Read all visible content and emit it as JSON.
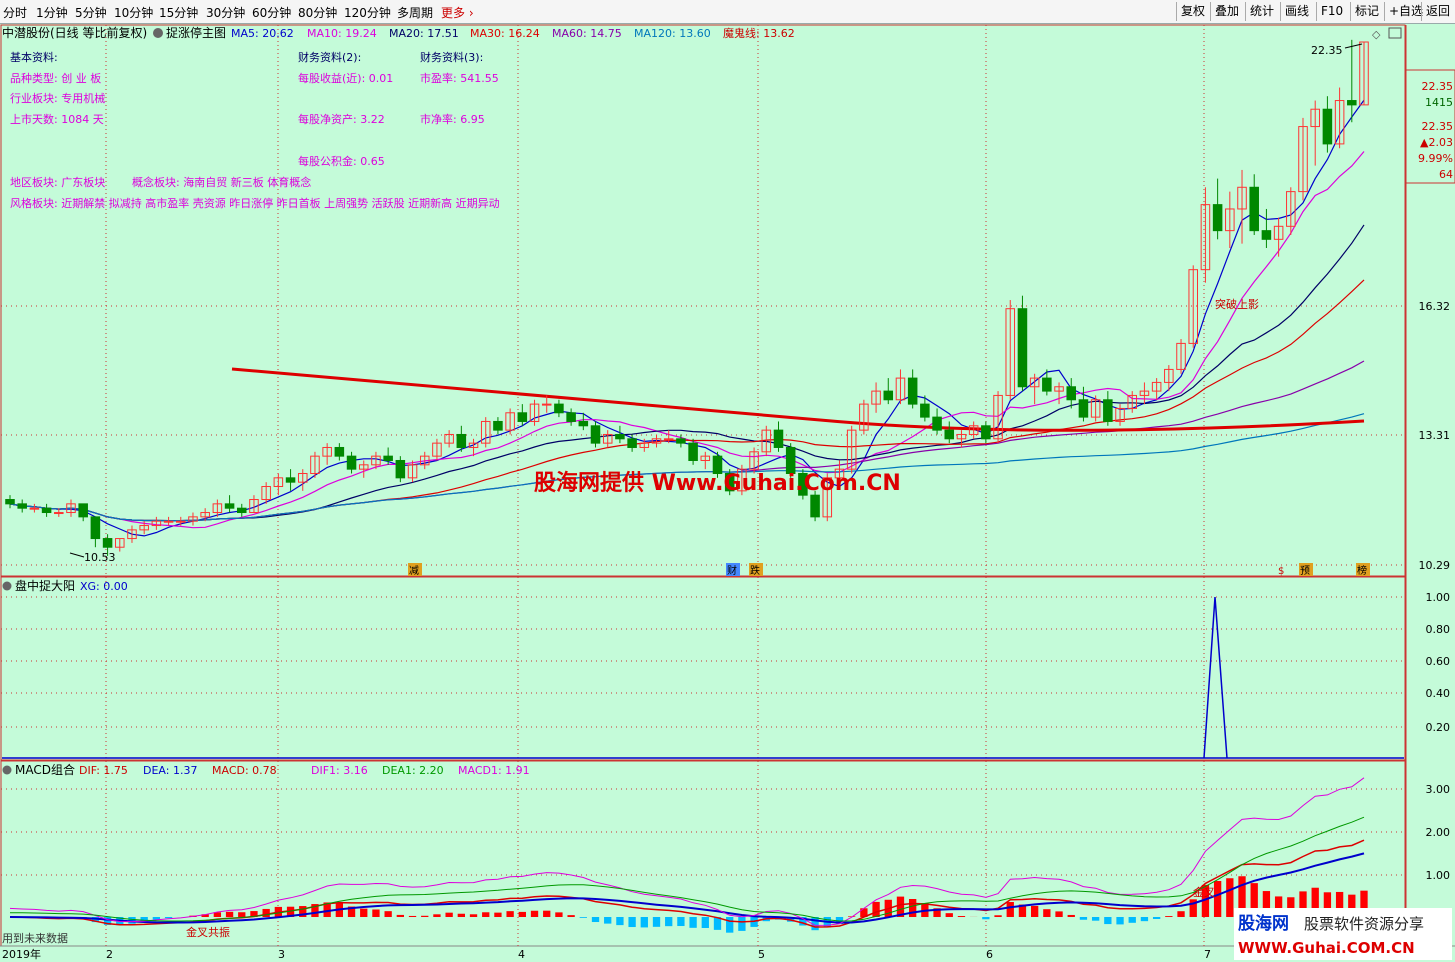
{
  "toolbar": {
    "timeframes": [
      "分时",
      "1分钟",
      "5分钟",
      "10分钟",
      "15分钟",
      "30分钟",
      "60分钟",
      "80分钟",
      "120分钟",
      "多周期"
    ],
    "more": "更多",
    "right_buttons": [
      "复权",
      "叠加",
      "统计",
      "画线",
      "F10",
      "标记",
      "+自选",
      "返回"
    ]
  },
  "header": {
    "title": "中潜股份(日线 等比前复权)",
    "indicator_name": "捉涨停主图",
    "ma": [
      {
        "label": "MA5: 20.62",
        "color": "#0000cc"
      },
      {
        "label": "MA10: 19.24",
        "color": "#dd00dd"
      },
      {
        "label": "MA20: 17.51",
        "color": "#000066"
      },
      {
        "label": "MA30: 16.24",
        "color": "#dd0000"
      },
      {
        "label": "MA60: 14.75",
        "color": "#8800aa"
      },
      {
        "label": "MA120: 13.60",
        "color": "#0077bb"
      },
      {
        "label": "魔鬼线: 13.62",
        "color": "#cc0000"
      }
    ]
  },
  "info": {
    "basic_title": "基本资料:",
    "basic": [
      "品种类型:  创 业 板",
      "行业板块:  专用机械",
      "上市天数: 1084    天"
    ],
    "fin2_title": "财务资料(2):",
    "fin2": [
      "每股收益(近): 0.01",
      "每股净资产:  3.22",
      "每股公积金:  0.65"
    ],
    "fin3_title": "财务资料(3):",
    "fin3": [
      "市盈率: 541.55",
      "市净率:   6.95"
    ],
    "region": "地区板块: 广东板块",
    "concept": "概念板块: 海南自贸 新三板 体育概念",
    "style": "风格板块: 近期解禁 拟减持 高市盈率 壳资源 昨日涨停 昨日首板 上周强势 活跃股 近期新高 近期异动"
  },
  "quote_box": {
    "high": "22.35",
    "vol": "1415",
    "price": "22.35",
    "change": "▲2.03",
    "pct": "9.99%",
    "num": "64"
  },
  "price_axis": [
    "16.32",
    "13.31",
    "10.29"
  ],
  "max_label": "22.35",
  "min_label": "10.53",
  "breakout_label": "突破上影",
  "watermark": "股海网提供 Www.Guhai.Com.CN",
  "event_markers": [
    "减",
    "财",
    "跌",
    "$",
    "预",
    "榜"
  ],
  "panel2": {
    "title": "盘中捉大阳",
    "xg": "XG: 0.00",
    "axis": [
      "1.00",
      "0.80",
      "0.60",
      "0.40",
      "0.20"
    ]
  },
  "panel3": {
    "title": "MACD组合",
    "items": [
      {
        "label": "DIF: 1.75",
        "color": "#cc0000"
      },
      {
        "label": "DEA: 1.37",
        "color": "#0000cc"
      },
      {
        "label": "MACD: 0.78",
        "color": "#cc0000"
      },
      {
        "label": "DIF1: 3.16",
        "color": "#dd00dd"
      },
      {
        "label": "DEA1: 2.20",
        "color": "#009900"
      },
      {
        "label": "MACD1: 1.91",
        "color": "#dd00dd"
      }
    ],
    "axis": [
      "3.00",
      "2.00",
      "1.00"
    ],
    "golden_cross": "金叉共振",
    "golden_cross2": "金叉",
    "future_note": "用到未来数据"
  },
  "date_axis": [
    "2019年",
    "2",
    "3",
    "4",
    "5",
    "6",
    "7"
  ],
  "logo": {
    "brand": "股海网",
    "tagline": "股票软件资源分享",
    "url": "WWW.Guhai.COM.CN"
  },
  "colors": {
    "bg": "#c4fbd9",
    "up": "#ff3333",
    "down": "#008800",
    "grid": "#cc3333",
    "axis": "#990000"
  },
  "chart_data": {
    "type": "candlestick",
    "x_months": [
      "1",
      "2",
      "3",
      "4",
      "5",
      "6",
      "7"
    ],
    "ylim": [
      10.0,
      23.0
    ],
    "y_ticks": [
      16.32,
      13.31,
      10.29
    ],
    "candles": [
      [
        11.8,
        11.9,
        11.6,
        11.7
      ],
      [
        11.7,
        11.8,
        11.5,
        11.6
      ],
      [
        11.6,
        11.7,
        11.5,
        11.6
      ],
      [
        11.6,
        11.7,
        11.4,
        11.5
      ],
      [
        11.5,
        11.6,
        11.4,
        11.5
      ],
      [
        11.5,
        11.8,
        11.4,
        11.7
      ],
      [
        11.7,
        11.7,
        11.3,
        11.4
      ],
      [
        11.4,
        11.4,
        10.7,
        10.9
      ],
      [
        10.9,
        11.0,
        10.5,
        10.7
      ],
      [
        10.7,
        10.9,
        10.6,
        10.9
      ],
      [
        10.9,
        11.2,
        10.8,
        11.1
      ],
      [
        11.1,
        11.3,
        11.0,
        11.2
      ],
      [
        11.2,
        11.4,
        11.1,
        11.3
      ],
      [
        11.3,
        11.4,
        11.2,
        11.3
      ],
      [
        11.3,
        11.4,
        11.2,
        11.3
      ],
      [
        11.3,
        11.5,
        11.2,
        11.4
      ],
      [
        11.4,
        11.6,
        11.3,
        11.5
      ],
      [
        11.5,
        11.8,
        11.4,
        11.7
      ],
      [
        11.7,
        11.9,
        11.5,
        11.6
      ],
      [
        11.6,
        11.7,
        11.4,
        11.5
      ],
      [
        11.5,
        11.9,
        11.5,
        11.8
      ],
      [
        11.8,
        12.2,
        11.7,
        12.1
      ],
      [
        12.1,
        12.4,
        11.9,
        12.3
      ],
      [
        12.3,
        12.5,
        12.0,
        12.2
      ],
      [
        12.2,
        12.5,
        12.0,
        12.4
      ],
      [
        12.4,
        12.9,
        12.3,
        12.8
      ],
      [
        12.8,
        13.1,
        12.6,
        13.0
      ],
      [
        13.0,
        13.1,
        12.7,
        12.8
      ],
      [
        12.8,
        12.9,
        12.4,
        12.5
      ],
      [
        12.5,
        12.7,
        12.3,
        12.6
      ],
      [
        12.6,
        12.9,
        12.5,
        12.8
      ],
      [
        12.8,
        13.0,
        12.6,
        12.7
      ],
      [
        12.7,
        12.8,
        12.2,
        12.3
      ],
      [
        12.3,
        12.7,
        12.2,
        12.6
      ],
      [
        12.6,
        12.9,
        12.5,
        12.8
      ],
      [
        12.8,
        13.2,
        12.7,
        13.1
      ],
      [
        13.1,
        13.4,
        13.0,
        13.3
      ],
      [
        13.3,
        13.5,
        12.9,
        13.0
      ],
      [
        13.0,
        13.2,
        12.8,
        13.1
      ],
      [
        13.1,
        13.7,
        13.0,
        13.6
      ],
      [
        13.6,
        13.7,
        13.3,
        13.4
      ],
      [
        13.4,
        13.9,
        13.3,
        13.8
      ],
      [
        13.8,
        14.0,
        13.5,
        13.6
      ],
      [
        13.6,
        14.1,
        13.5,
        14.0
      ],
      [
        14.0,
        14.2,
        13.8,
        14.0
      ],
      [
        14.0,
        14.1,
        13.7,
        13.8
      ],
      [
        13.8,
        13.9,
        13.5,
        13.6
      ],
      [
        13.6,
        13.8,
        13.4,
        13.5
      ],
      [
        13.5,
        13.6,
        13.0,
        13.1
      ],
      [
        13.1,
        13.4,
        13.0,
        13.3
      ],
      [
        13.3,
        13.5,
        13.1,
        13.2
      ],
      [
        13.2,
        13.3,
        12.9,
        13.0
      ],
      [
        13.0,
        13.2,
        12.9,
        13.1
      ],
      [
        13.1,
        13.3,
        13.0,
        13.2
      ],
      [
        13.2,
        13.4,
        13.1,
        13.2
      ],
      [
        13.2,
        13.3,
        13.0,
        13.1
      ],
      [
        13.1,
        13.2,
        12.6,
        12.7
      ],
      [
        12.7,
        12.9,
        12.5,
        12.8
      ],
      [
        12.8,
        12.9,
        12.3,
        12.4
      ],
      [
        12.4,
        12.5,
        11.9,
        12.0
      ],
      [
        12.0,
        12.6,
        11.9,
        12.5
      ],
      [
        12.5,
        13.0,
        12.4,
        12.9
      ],
      [
        12.9,
        13.5,
        12.8,
        13.4
      ],
      [
        13.4,
        13.6,
        12.9,
        13.0
      ],
      [
        13.0,
        13.1,
        12.3,
        12.4
      ],
      [
        12.4,
        12.5,
        11.8,
        11.9
      ],
      [
        11.9,
        12.0,
        11.3,
        11.4
      ],
      [
        11.4,
        12.4,
        11.3,
        12.3
      ],
      [
        12.3,
        12.7,
        12.1,
        12.5
      ],
      [
        12.5,
        13.5,
        12.4,
        13.4
      ],
      [
        13.4,
        14.1,
        13.3,
        14.0
      ],
      [
        14.0,
        14.5,
        13.8,
        14.3
      ],
      [
        14.3,
        14.6,
        14.0,
        14.1
      ],
      [
        14.1,
        14.8,
        14.0,
        14.6
      ],
      [
        14.6,
        14.8,
        13.9,
        14.0
      ],
      [
        14.0,
        14.2,
        13.6,
        13.7
      ],
      [
        13.7,
        13.9,
        13.3,
        13.4
      ],
      [
        13.4,
        13.6,
        13.1,
        13.2
      ],
      [
        13.2,
        13.4,
        13.0,
        13.3
      ],
      [
        13.3,
        13.6,
        13.2,
        13.5
      ],
      [
        13.5,
        13.6,
        13.1,
        13.2
      ],
      [
        13.2,
        14.3,
        13.1,
        14.2
      ],
      [
        14.2,
        16.4,
        14.1,
        16.2
      ],
      [
        16.2,
        16.5,
        14.3,
        14.4
      ],
      [
        14.4,
        14.7,
        14.0,
        14.6
      ],
      [
        14.6,
        14.8,
        14.2,
        14.3
      ],
      [
        14.3,
        14.5,
        14.0,
        14.4
      ],
      [
        14.4,
        14.6,
        13.9,
        14.1
      ],
      [
        14.1,
        14.4,
        13.6,
        13.7
      ],
      [
        13.7,
        14.2,
        13.6,
        14.1
      ],
      [
        14.1,
        14.3,
        13.5,
        13.6
      ],
      [
        13.6,
        14.0,
        13.5,
        13.9
      ],
      [
        13.9,
        14.3,
        13.8,
        14.2
      ],
      [
        14.2,
        14.5,
        14.0,
        14.3
      ],
      [
        14.3,
        14.6,
        14.1,
        14.5
      ],
      [
        14.5,
        14.9,
        14.3,
        14.8
      ],
      [
        14.8,
        15.5,
        14.7,
        15.4
      ],
      [
        15.4,
        17.2,
        15.3,
        17.1
      ],
      [
        17.1,
        19.0,
        16.8,
        18.6
      ],
      [
        18.6,
        19.2,
        17.8,
        18.0
      ],
      [
        18.0,
        18.9,
        17.6,
        18.5
      ],
      [
        18.5,
        19.4,
        17.7,
        19.0
      ],
      [
        19.0,
        19.3,
        17.9,
        18.0
      ],
      [
        18.0,
        18.5,
        17.6,
        17.8
      ],
      [
        17.8,
        18.3,
        17.4,
        18.1
      ],
      [
        18.1,
        19.0,
        17.9,
        18.9
      ],
      [
        18.9,
        20.6,
        18.7,
        20.4
      ],
      [
        20.4,
        21.0,
        19.5,
        20.8
      ],
      [
        20.8,
        21.1,
        19.8,
        20.0
      ],
      [
        20.0,
        21.3,
        19.9,
        21.0
      ],
      [
        21.0,
        22.4,
        20.5,
        20.9
      ],
      [
        20.9,
        22.35,
        20.9,
        22.35
      ]
    ]
  }
}
